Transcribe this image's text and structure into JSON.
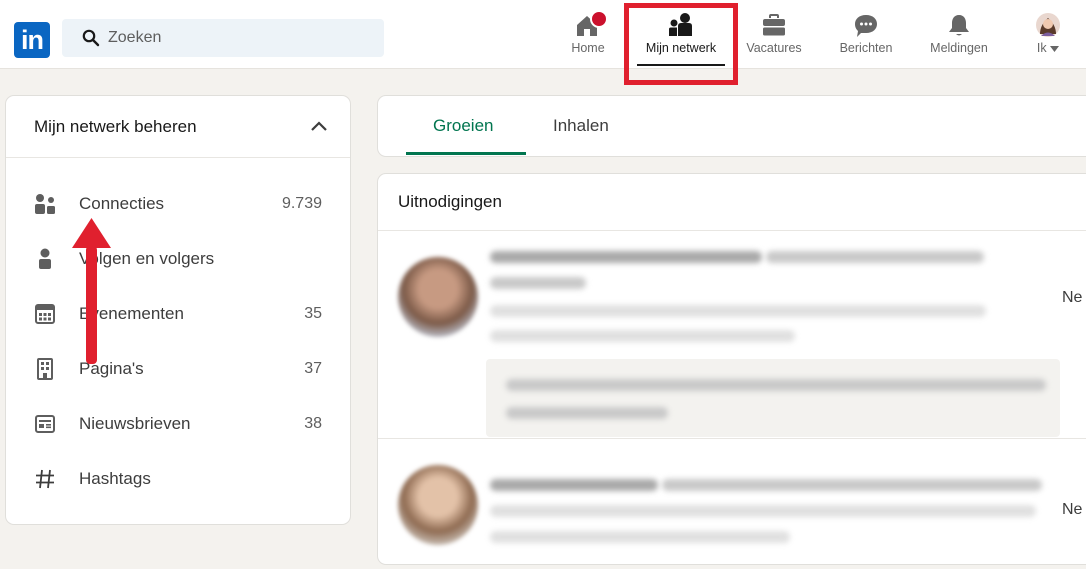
{
  "brand": {
    "logo_text": "in",
    "color": "#0a66c2"
  },
  "search": {
    "placeholder": "Zoeken",
    "icon": "search-icon"
  },
  "nav": {
    "items": [
      {
        "label": "Home",
        "icon": "home-icon",
        "active": false,
        "notification": true
      },
      {
        "label": "Mijn netwerk",
        "icon": "network-icon",
        "active": true,
        "highlighted": true
      },
      {
        "label": "Vacatures",
        "icon": "briefcase-icon",
        "active": false
      },
      {
        "label": "Berichten",
        "icon": "messaging-icon",
        "active": false
      },
      {
        "label": "Meldingen",
        "icon": "bell-icon",
        "active": false
      },
      {
        "label": "Ik",
        "icon": "avatar",
        "active": false,
        "dropdown": true
      }
    ]
  },
  "manage": {
    "title": "Mijn netwerk beheren",
    "collapse_icon": "chevron-up-icon",
    "items": [
      {
        "label": "Connecties",
        "count": "9.739",
        "icon": "connections-icon"
      },
      {
        "label": "Volgen en volgers",
        "count": "",
        "icon": "person-icon"
      },
      {
        "label": "Evenementen",
        "count": "35",
        "icon": "calendar-icon"
      },
      {
        "label": "Pagina's",
        "count": "37",
        "icon": "building-icon"
      },
      {
        "label": "Nieuwsbrieven",
        "count": "38",
        "icon": "newsletter-icon"
      },
      {
        "label": "Hashtags",
        "count": "",
        "icon": "hashtag-icon"
      }
    ]
  },
  "tabs": [
    {
      "label": "Groeien",
      "active": true
    },
    {
      "label": "Inhalen",
      "active": false
    }
  ],
  "invitations": {
    "title": "Uitnodigingen",
    "rows": [
      {
        "action_label": "Ne"
      },
      {
        "action_label": "Ne"
      }
    ]
  },
  "colors": {
    "accent_green": "#01754f",
    "highlight_red": "#e0202e",
    "notification_red": "#cb112d"
  }
}
